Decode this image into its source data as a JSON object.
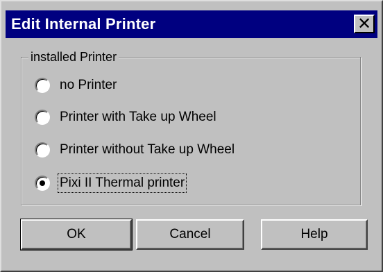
{
  "window": {
    "title": "Edit Internal Printer",
    "close_glyph": "✕"
  },
  "group": {
    "label": "installed Printer",
    "options": [
      {
        "label": "no Printer",
        "selected": false
      },
      {
        "label": "Printer with Take up Wheel",
        "selected": false
      },
      {
        "label": "Printer without Take up Wheel",
        "selected": false
      },
      {
        "label": "Pixi II Thermal printer",
        "selected": true
      }
    ]
  },
  "buttons": {
    "ok": "OK",
    "cancel": "Cancel",
    "help": "Help"
  },
  "colors": {
    "titlebar": "#000080",
    "face": "#c0c0c0"
  }
}
